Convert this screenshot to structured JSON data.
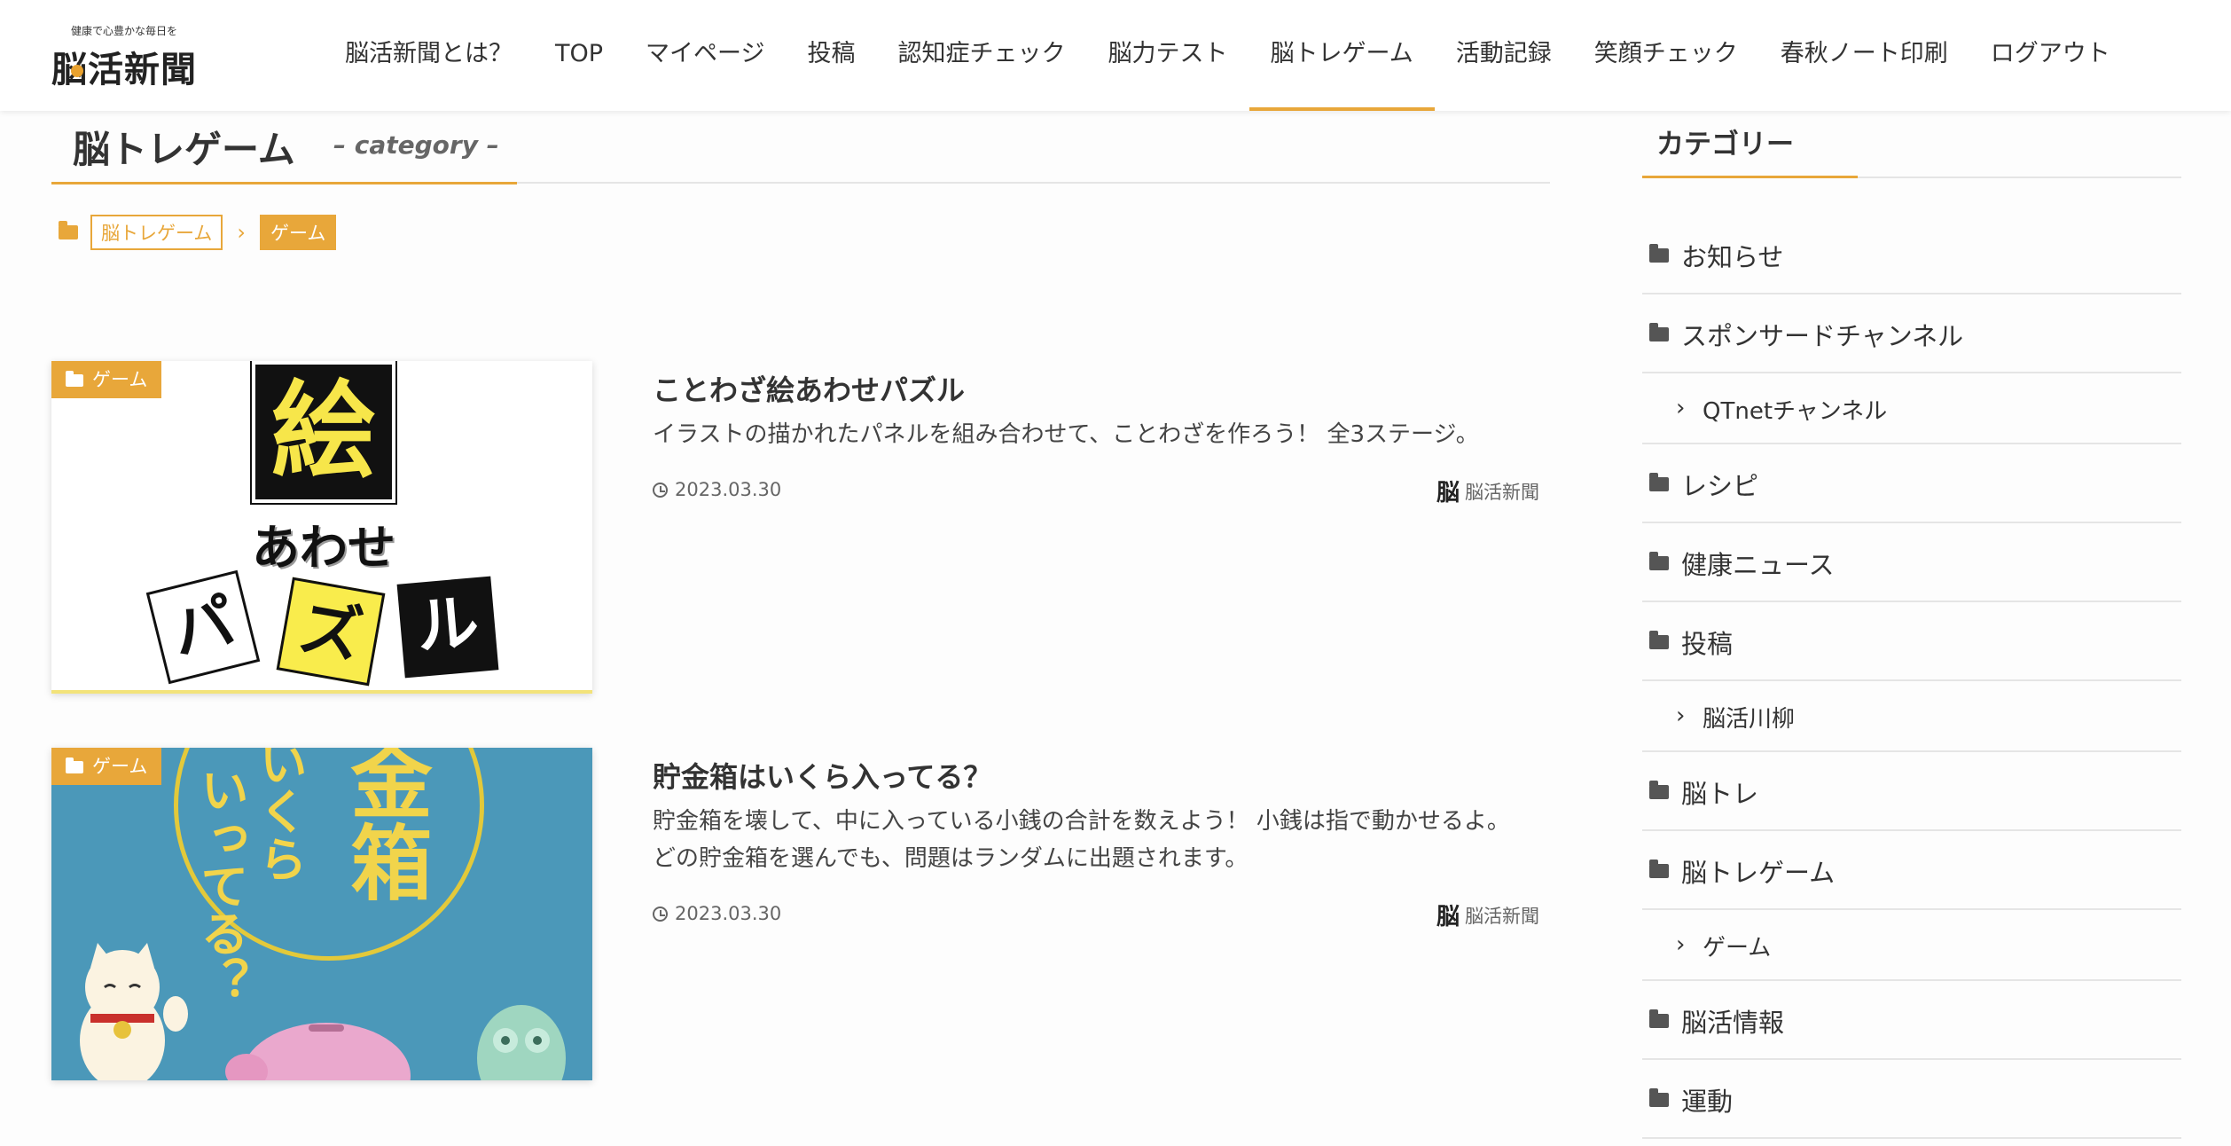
{
  "logo": {
    "tagline": "健康で心豊かな毎日を",
    "name": "脳活新聞"
  },
  "nav": [
    "脳活新聞とは？",
    "TOP",
    "マイページ",
    "投稿",
    "認知症チェック",
    "脳力テスト",
    "脳トレゲーム",
    "活動記録",
    "笑顔チェック",
    "春秋ノート印刷",
    "ログアウト"
  ],
  "nav_active": "脳トレゲーム",
  "archive": {
    "title": "脳トレゲーム",
    "subtitle": "– category –"
  },
  "breadcrumb": {
    "parent": "脳トレゲーム",
    "separator": "›",
    "current": "ゲーム"
  },
  "posts": [
    {
      "category": "ゲーム",
      "title": "ことわざ絵あわせパズル",
      "excerpt": "イラストの描かれたパネルを組み合わせて、ことわざを作ろう！ 全3ステージ。",
      "date": "2023.03.30",
      "author": "脳活新聞",
      "thumb": {
        "big": "絵",
        "mid": "あわせ",
        "tiles": [
          "パ",
          "ズ",
          "ル"
        ]
      }
    },
    {
      "category": "ゲーム",
      "title": "貯金箱はいくら入ってる？",
      "excerpt": "貯金箱を壊して、中に入っている小銭の合計を数えよう！ 小銭は指で動かせるよ。 どの貯金箱を選んでも、問題はランダムに出題されます。",
      "date": "2023.03.30",
      "author": "脳活新聞",
      "thumb": {
        "big": "金箱",
        "mid": "いくら",
        "small": "いってる？"
      }
    }
  ],
  "sidebar": {
    "title": "カテゴリー",
    "categories": [
      {
        "label": "お知らせ",
        "level": 0
      },
      {
        "label": "スポンサードチャンネル",
        "level": 0
      },
      {
        "label": "QTnetチャンネル",
        "level": 1
      },
      {
        "label": "レシピ",
        "level": 0
      },
      {
        "label": "健康ニュース",
        "level": 0
      },
      {
        "label": "投稿",
        "level": 0
      },
      {
        "label": "脳活川柳",
        "level": 1
      },
      {
        "label": "脳トレ",
        "level": 0
      },
      {
        "label": "脳トレゲーム",
        "level": 0
      },
      {
        "label": "ゲーム",
        "level": 1
      },
      {
        "label": "脳活情報",
        "level": 0
      },
      {
        "label": "運動",
        "level": 0
      }
    ]
  },
  "colors": {
    "accent": "#e8a73a",
    "thumb2_bg": "#4b98b9",
    "thumb_yellow": "#f9ec4c"
  }
}
